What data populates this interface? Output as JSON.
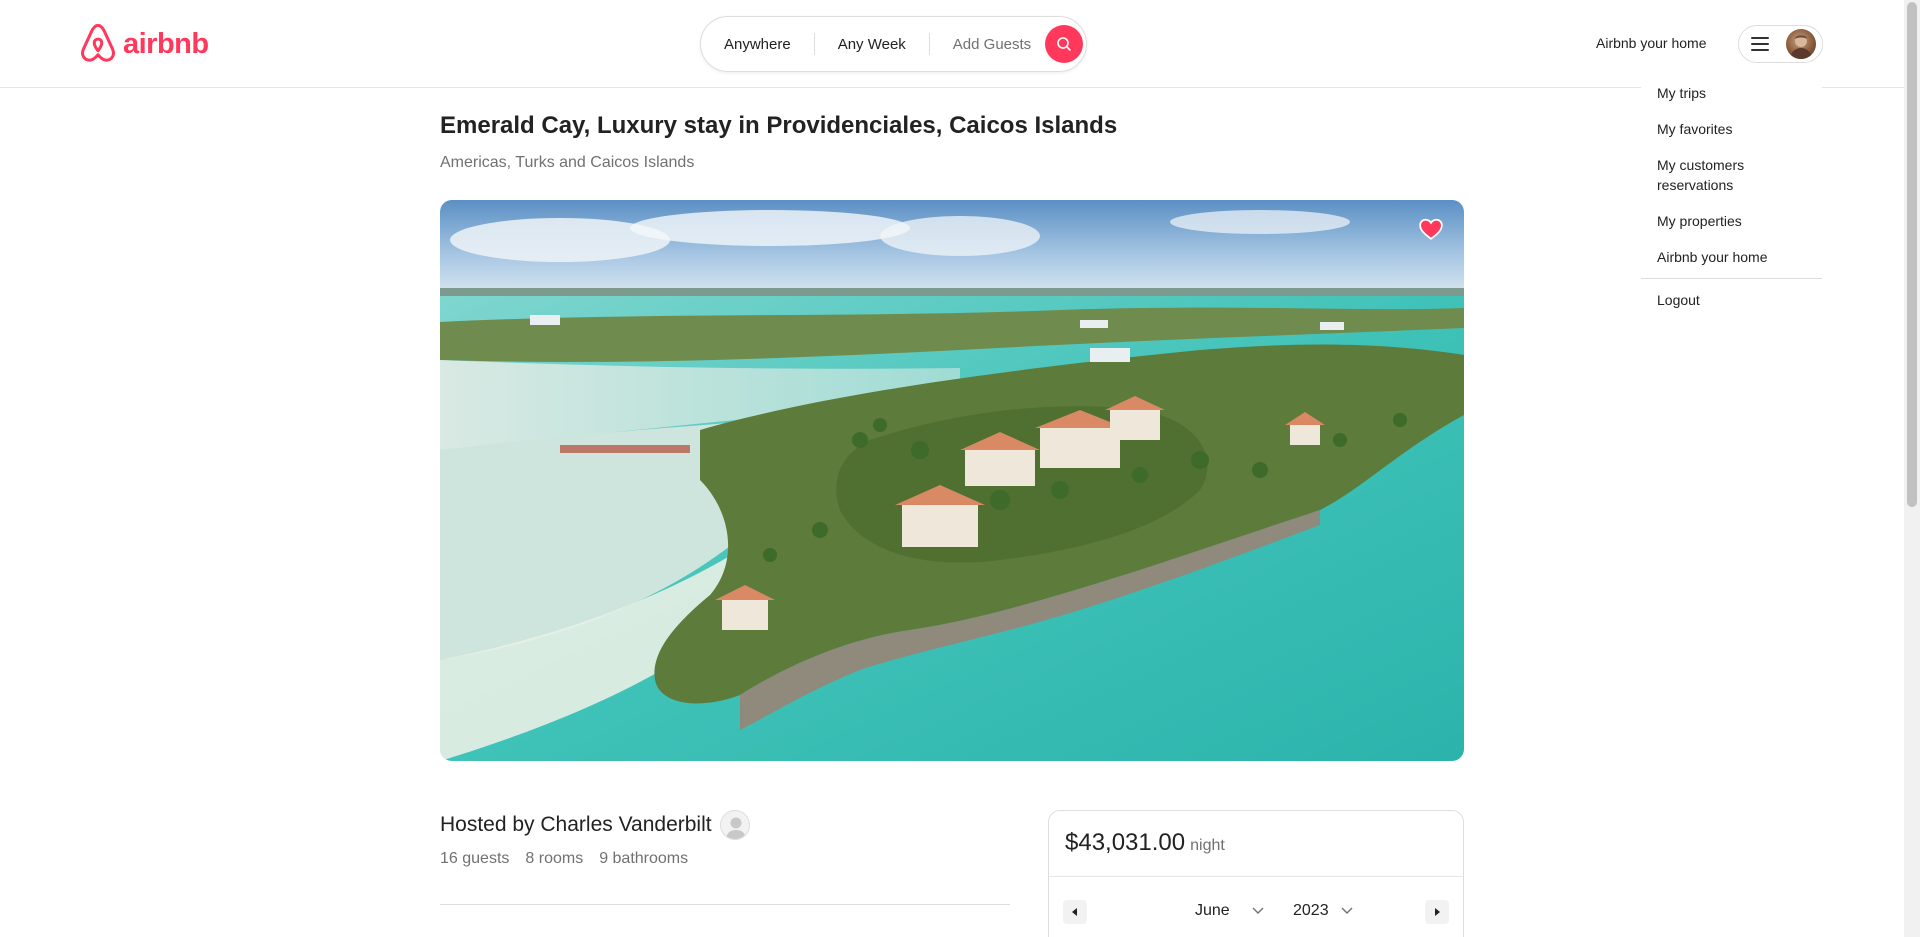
{
  "header": {
    "logo_text": "airbnb",
    "search": {
      "anywhere": "Anywhere",
      "any_week": "Any Week",
      "add_guests": "Add Guests"
    },
    "host_link": "Airbnb your home"
  },
  "dropdown": {
    "items": [
      "My trips",
      "My favorites",
      "My customers reservations",
      "My properties",
      "Airbnb your home"
    ],
    "logout": "Logout"
  },
  "listing": {
    "title": "Emerald Cay, Luxury stay in Providenciales, Caicos Islands",
    "location": "Americas, Turks and Caicos Islands",
    "favorited": true,
    "host_line": "Hosted by Charles Vanderbilt",
    "guests": "16 guests",
    "rooms": "8 rooms",
    "bathrooms": "9 bathrooms"
  },
  "booking": {
    "price": "$43,031.00",
    "per": "night",
    "month": "June",
    "year": "2023"
  },
  "colors": {
    "brand": "#ff385c",
    "text": "#222222",
    "muted": "#717171",
    "border": "#dddddd"
  }
}
